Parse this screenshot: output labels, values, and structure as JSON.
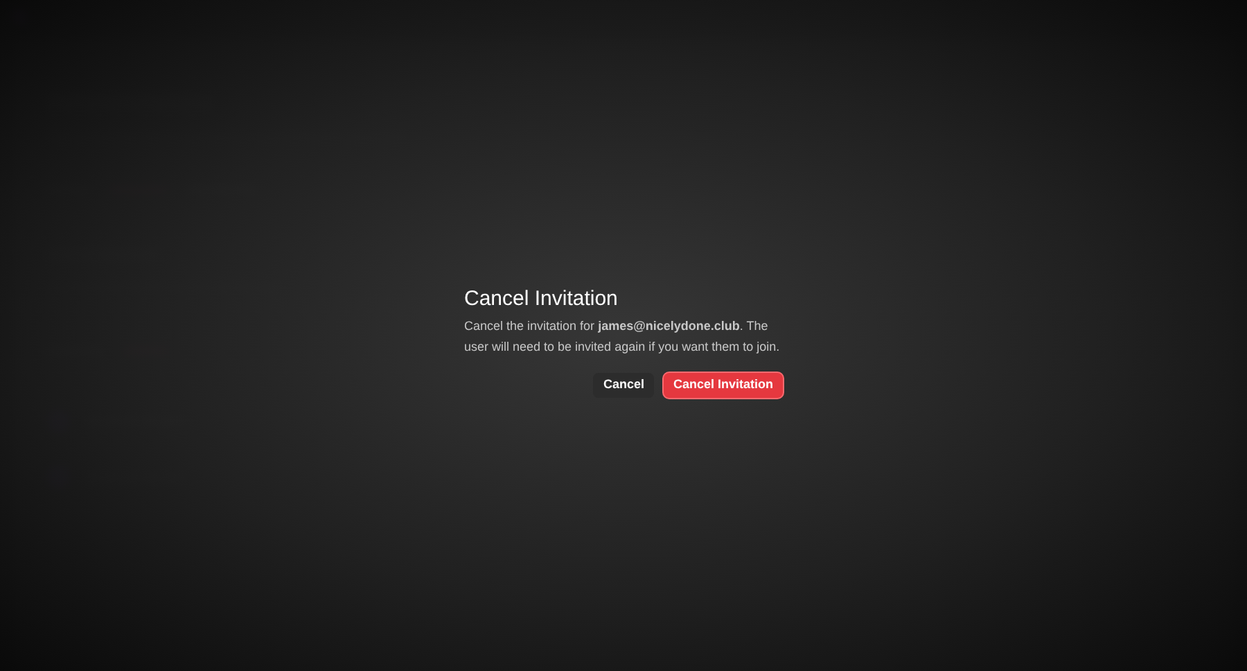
{
  "dialog": {
    "title": "Cancel Invitation",
    "message": "Cancel the invitation for **james@nicelydone.club**. The user will need to be invited again if you want them to join.",
    "buttons": [
      {
        "label": "Cancel",
        "kind": "secondary"
      },
      {
        "label": "Cancel Invitation",
        "kind": "danger"
      }
    ]
  }
}
